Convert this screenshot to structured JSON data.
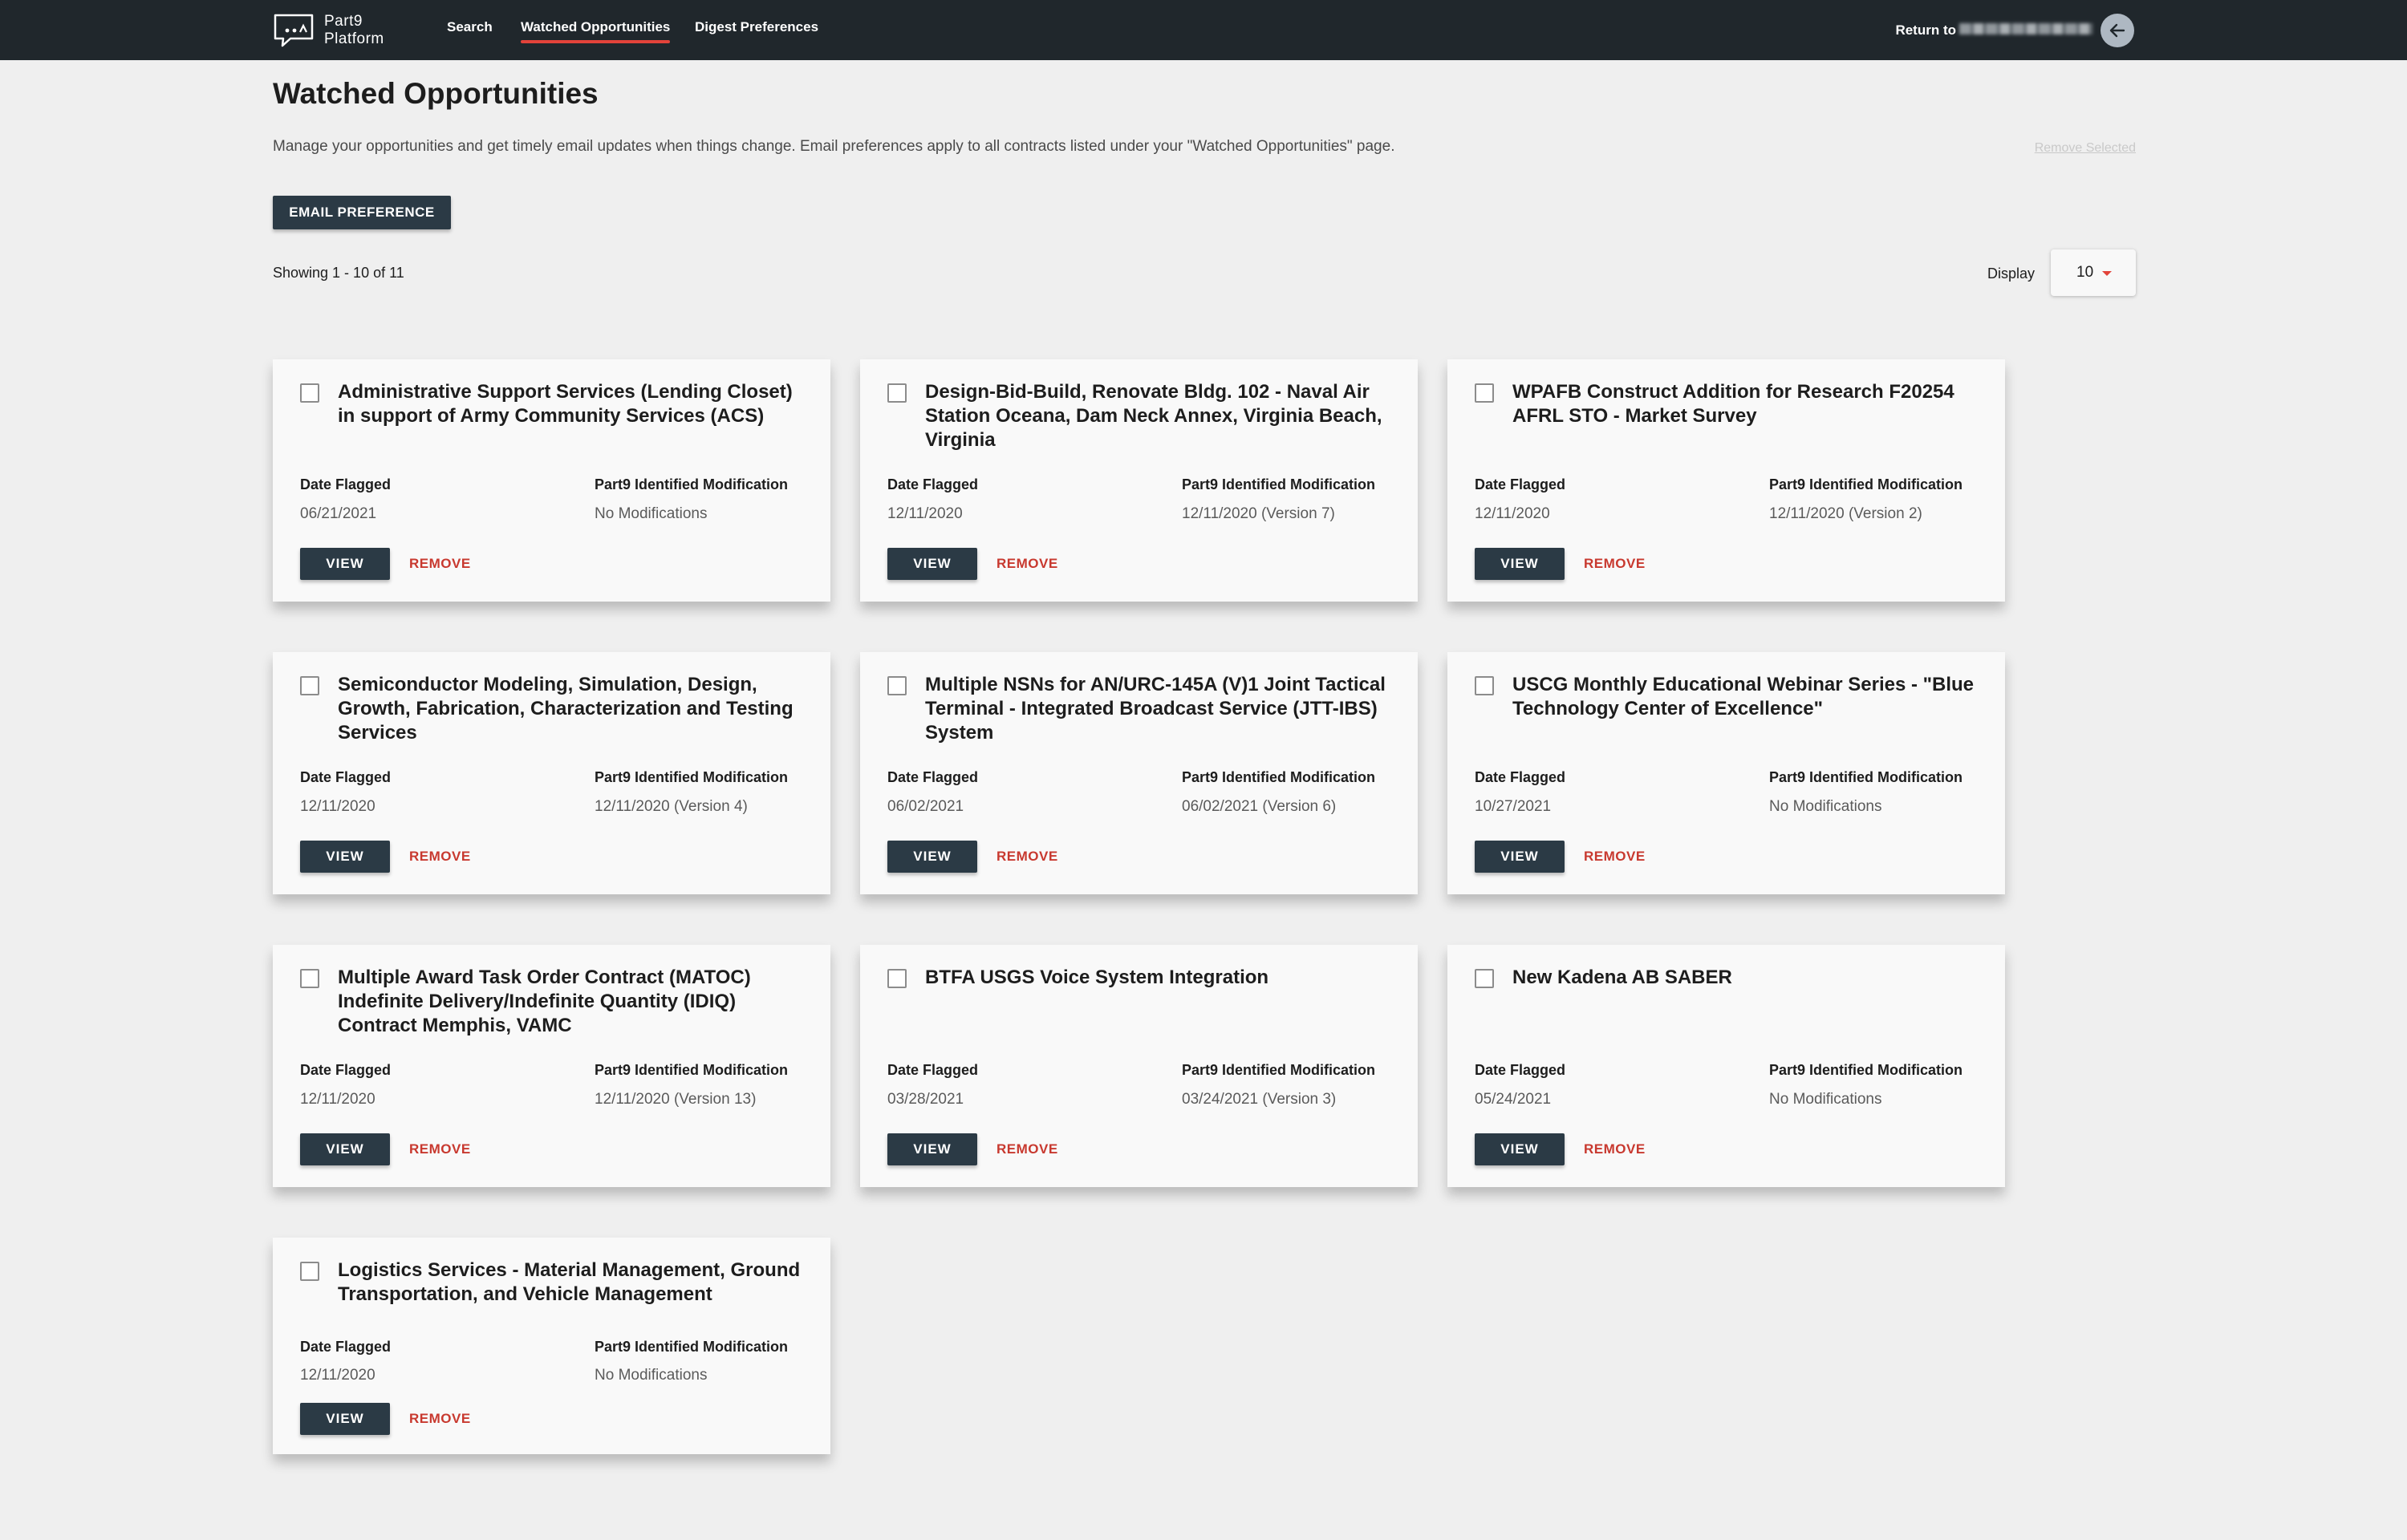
{
  "nav": {
    "logo_line1": "Part9",
    "logo_line2": "Platform",
    "links": [
      "Search",
      "Watched Opportunities",
      "Digest Preferences"
    ],
    "active_link": "Watched Opportunities",
    "return_label": "Return to"
  },
  "page": {
    "title": "Watched Opportunities",
    "description": "Manage your opportunities and get timely email updates when things change. Email preferences apply to all contracts listed under your \"Watched Opportunities\" page.",
    "remove_selected": "Remove Selected",
    "email_pref_button": "EMAIL PREFERENCE",
    "showing": "Showing 1 - 10 of 11",
    "display_label": "Display",
    "display_value": "10"
  },
  "card_labels": {
    "date_flagged": "Date Flagged",
    "modification": "Part9 Identified Modification",
    "view": "VIEW",
    "remove": "REMOVE"
  },
  "cards": [
    {
      "title": "Administrative Support Services (Lending Closet) in support of Army Community Services (ACS)",
      "date": "06/21/2021",
      "mod": "No Modifications"
    },
    {
      "title": "Design-Bid-Build, Renovate Bldg. 102 - Naval Air Station Oceana, Dam Neck Annex, Virginia Beach, Virginia",
      "date": "12/11/2020",
      "mod": "12/11/2020 (Version 7)"
    },
    {
      "title": "WPAFB Construct Addition for Research F20254 AFRL STO - Market Survey",
      "date": "12/11/2020",
      "mod": "12/11/2020 (Version 2)"
    },
    {
      "title": "Semiconductor Modeling, Simulation, Design, Growth, Fabrication, Characterization and Testing Services",
      "date": "12/11/2020",
      "mod": "12/11/2020 (Version 4)"
    },
    {
      "title": "Multiple NSNs for AN/URC-145A (V)1 Joint Tactical Terminal - Integrated Broadcast Service (JTT-IBS) System",
      "date": "06/02/2021",
      "mod": "06/02/2021 (Version 6)"
    },
    {
      "title": "USCG Monthly Educational Webinar Series - \"Blue Technology Center of Excellence\"",
      "date": "10/27/2021",
      "mod": "No Modifications"
    },
    {
      "title": "Multiple Award Task Order Contract (MATOC) Indefinite Delivery/Indefinite Quantity (IDIQ) Contract Memphis, VAMC",
      "date": "12/11/2020",
      "mod": "12/11/2020 (Version 13)"
    },
    {
      "title": "BTFA USGS Voice System Integration",
      "date": "03/28/2021",
      "mod": "03/24/2021 (Version 3)"
    },
    {
      "title": "New Kadena AB SABER",
      "date": "05/24/2021",
      "mod": "No Modifications"
    },
    {
      "title": "Logistics Services - Material Management, Ground Transportation, and Vehicle Management",
      "date": "12/11/2020",
      "mod": "No Modifications"
    }
  ],
  "colors": {
    "topbar": "#20272c",
    "accent": "#e2433a",
    "button": "#2b3a45",
    "remove": "#c8392f",
    "background": "#efefef"
  }
}
